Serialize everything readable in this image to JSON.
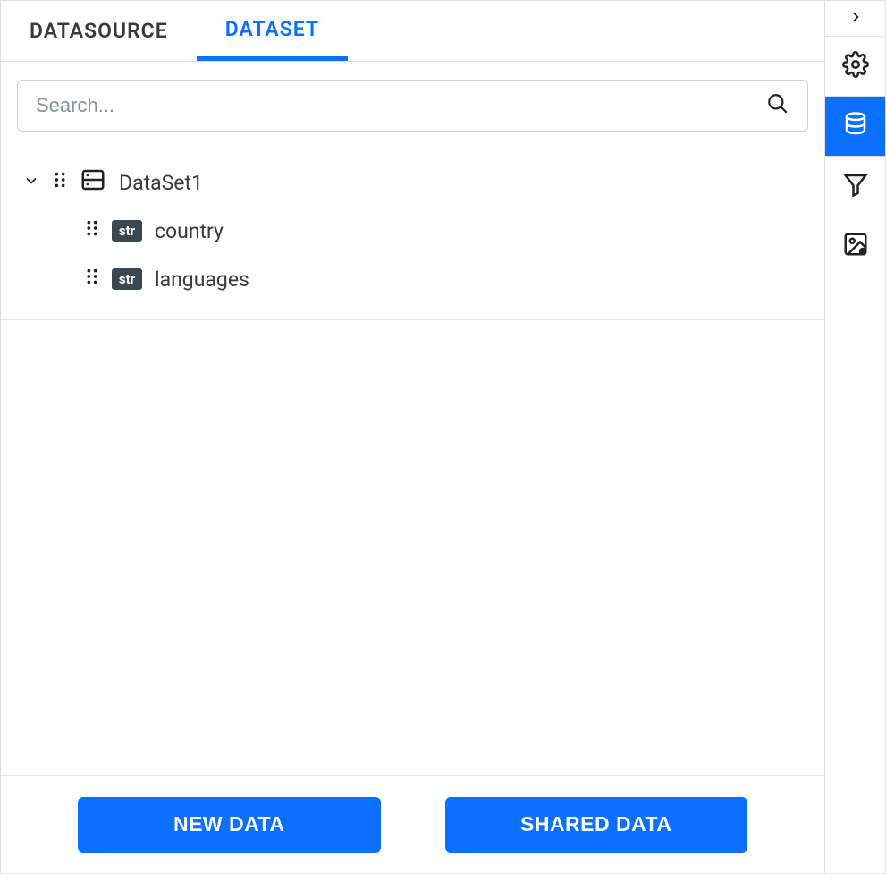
{
  "tabs": {
    "datasource": "DATASOURCE",
    "dataset": "DATASET"
  },
  "search": {
    "placeholder": "Search..."
  },
  "tree": {
    "dataset": {
      "name": "DataSet1",
      "fields": [
        {
          "type": "str",
          "name": "country"
        },
        {
          "type": "str",
          "name": "languages"
        }
      ]
    }
  },
  "actions": {
    "new_data": "NEW DATA",
    "shared_data": "SHARED DATA"
  }
}
